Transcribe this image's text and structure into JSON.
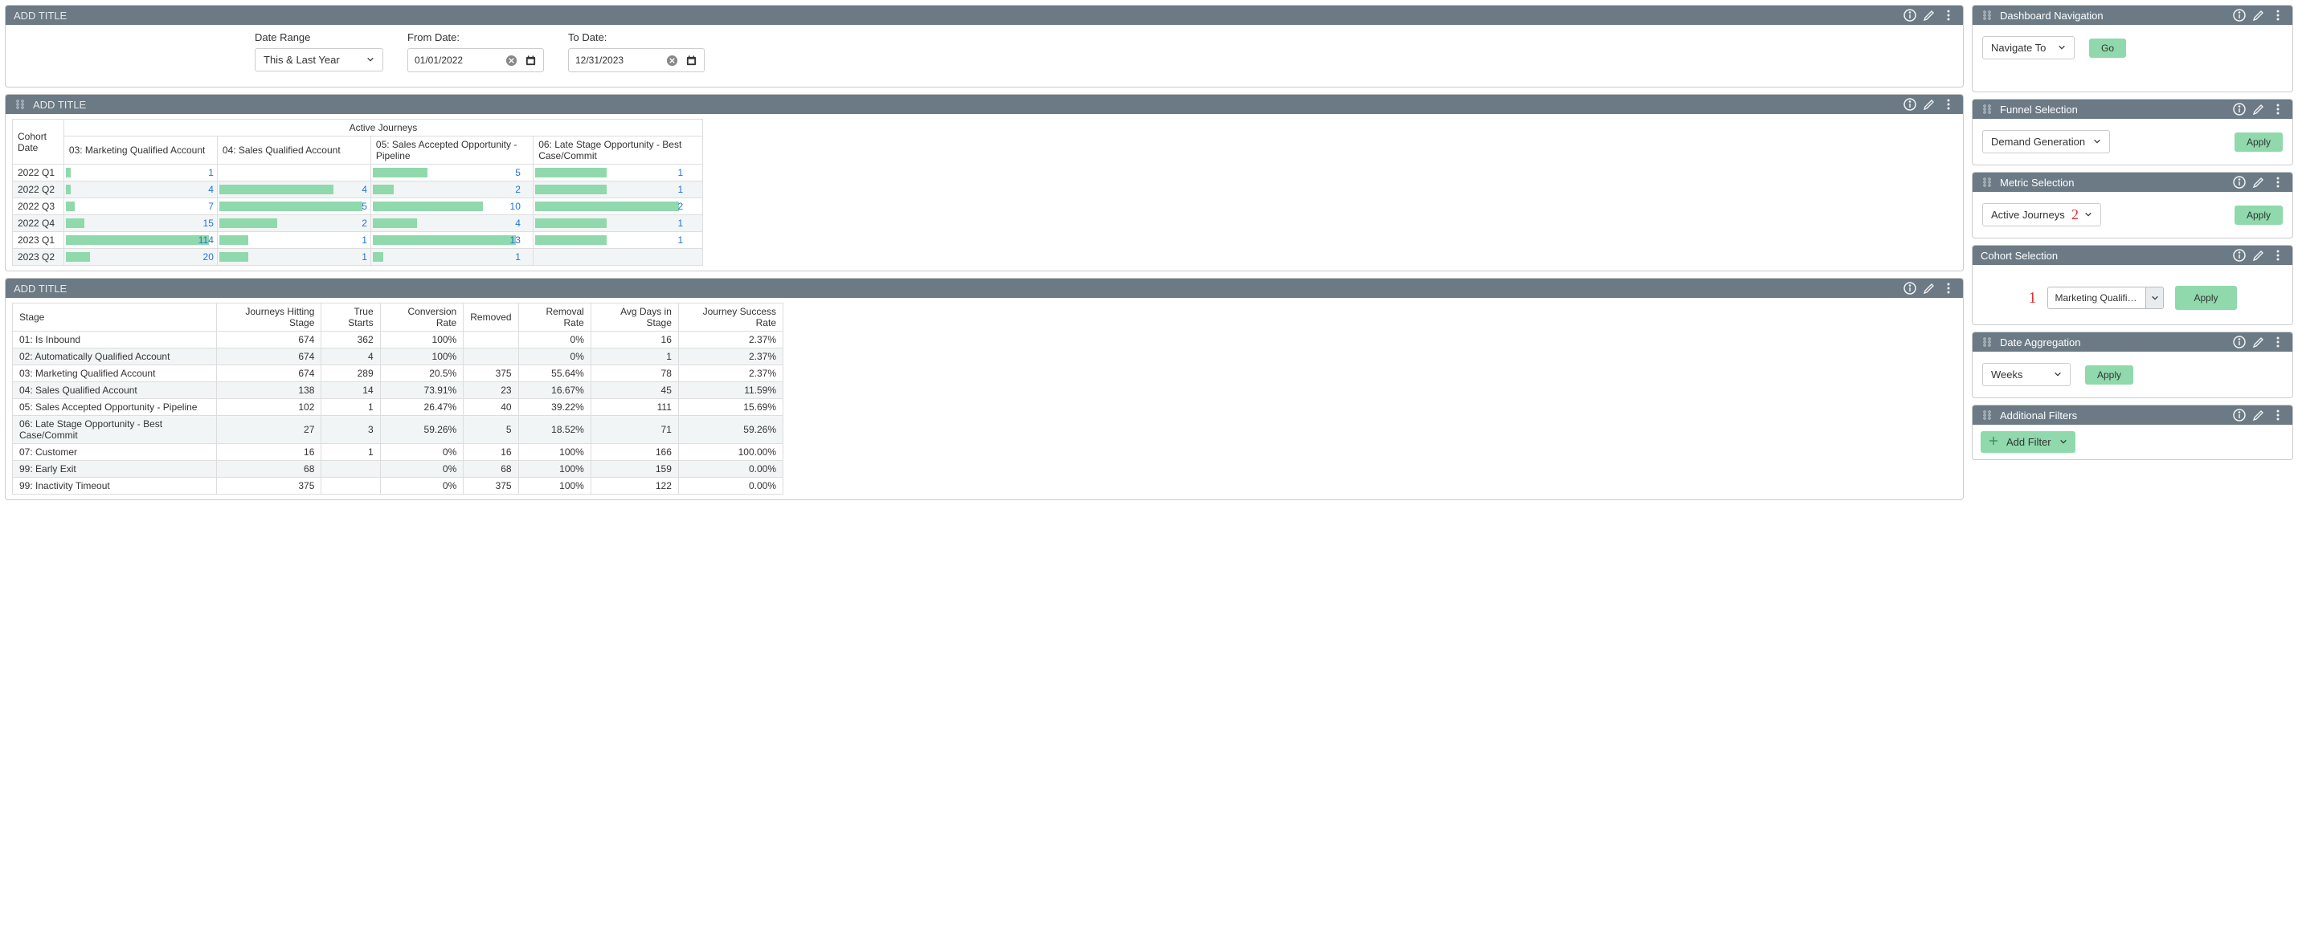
{
  "add_title_placeholder": "ADD TITLE",
  "top_filters": {
    "date_range_label": "Date Range",
    "date_range_value": "This & Last Year",
    "from_label": "From Date:",
    "from_value": "01/01/2022",
    "to_label": "To Date:",
    "to_value": "12/31/2023"
  },
  "chart_data": {
    "type": "bar",
    "title": "Active Journeys",
    "row_header": "Cohort Date",
    "categories": [
      "2022 Q1",
      "2022 Q2",
      "2022 Q3",
      "2022 Q4",
      "2023 Q1",
      "2023 Q2"
    ],
    "series": [
      {
        "name": "03: Marketing Qualified Account",
        "values": [
          1,
          4,
          7,
          15,
          114,
          20
        ],
        "max": 114
      },
      {
        "name": "04: Sales Qualified Account",
        "values": [
          null,
          4,
          5,
          2,
          1,
          1
        ],
        "max": 5
      },
      {
        "name": "05: Sales Accepted Opportunity - Pipeline",
        "values": [
          5,
          2,
          10,
          4,
          13,
          1
        ],
        "max": 13
      },
      {
        "name": "06: Late Stage Opportunity - Best Case/Commit",
        "values": [
          1,
          1,
          2,
          1,
          1,
          null
        ],
        "max": 2
      }
    ]
  },
  "stage_table": {
    "headers": [
      "Stage",
      "Journeys Hitting Stage",
      "True Starts",
      "Conversion Rate",
      "Removed",
      "Removal Rate",
      "Avg Days in Stage",
      "Journey Success Rate"
    ],
    "rows": [
      {
        "stage": "01: Is Inbound",
        "hit": "674",
        "starts": "362",
        "conv": "100%",
        "removed": "",
        "rrate": "0%",
        "days": "16",
        "succ": "2.37%"
      },
      {
        "stage": "02: Automatically Qualified Account",
        "hit": "674",
        "starts": "4",
        "conv": "100%",
        "removed": "",
        "rrate": "0%",
        "days": "1",
        "succ": "2.37%"
      },
      {
        "stage": "03: Marketing Qualified Account",
        "hit": "674",
        "starts": "289",
        "conv": "20.5%",
        "removed": "375",
        "rrate": "55.64%",
        "days": "78",
        "succ": "2.37%"
      },
      {
        "stage": "04: Sales Qualified Account",
        "hit": "138",
        "starts": "14",
        "conv": "73.91%",
        "removed": "23",
        "rrate": "16.67%",
        "days": "45",
        "succ": "11.59%"
      },
      {
        "stage": "05: Sales Accepted Opportunity - Pipeline",
        "hit": "102",
        "starts": "1",
        "conv": "26.47%",
        "removed": "40",
        "rrate": "39.22%",
        "days": "111",
        "succ": "15.69%"
      },
      {
        "stage": "06: Late Stage Opportunity - Best Case/Commit",
        "hit": "27",
        "starts": "3",
        "conv": "59.26%",
        "removed": "5",
        "rrate": "18.52%",
        "days": "71",
        "succ": "59.26%"
      },
      {
        "stage": "07: Customer",
        "hit": "16",
        "starts": "1",
        "conv": "0%",
        "removed": "16",
        "rrate": "100%",
        "days": "166",
        "succ": "100.00%"
      },
      {
        "stage": "99: Early Exit",
        "hit": "68",
        "starts": "",
        "conv": "0%",
        "removed": "68",
        "rrate": "100%",
        "days": "159",
        "succ": "0.00%"
      },
      {
        "stage": "99: Inactivity Timeout",
        "hit": "375",
        "starts": "",
        "conv": "0%",
        "removed": "375",
        "rrate": "100%",
        "days": "122",
        "succ": "0.00%"
      }
    ]
  },
  "sidebar": {
    "nav": {
      "title": "Dashboard Navigation",
      "dropdown": "Navigate To",
      "button": "Go"
    },
    "funnel": {
      "title": "Funnel Selection",
      "dropdown": "Demand Generation",
      "button": "Apply"
    },
    "metric": {
      "title": "Metric Selection",
      "dropdown": "Active Journeys",
      "button": "Apply",
      "anno": "2"
    },
    "cohort": {
      "title": "Cohort Selection",
      "dropdown": "Marketing Qualified Ac...",
      "button": "Apply",
      "anno": "1"
    },
    "date_agg": {
      "title": "Date Aggregation",
      "dropdown": "Weeks",
      "button": "Apply"
    },
    "add_filters": {
      "title": "Additional Filters",
      "button": "Add Filter"
    }
  }
}
